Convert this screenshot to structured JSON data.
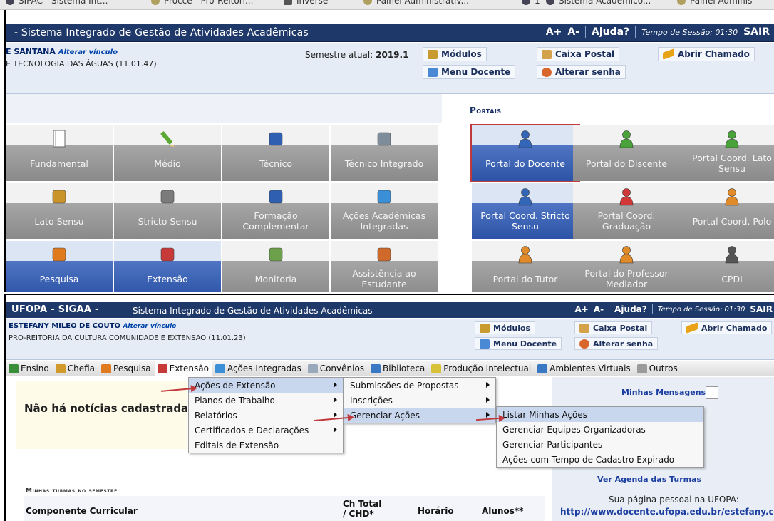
{
  "bookmarks": [
    {
      "label": "SIPAC - Sistema Int...",
      "icon": "sipac-icon"
    },
    {
      "label": "Procce - Pró-Reitori...",
      "icon": "folder-icon"
    },
    {
      "label": "Inverse",
      "icon": "inverse-icon"
    },
    {
      "label": "Painel Administrativ...",
      "icon": "folder-icon"
    },
    {
      "label": "1",
      "icon": "sipac-icon"
    },
    {
      "label": "Sistema Acadêmico...",
      "icon": "sipac-icon"
    },
    {
      "label": "Painel Adminis",
      "icon": "folder-icon"
    }
  ],
  "shot1": {
    "title": "Sistema Integrado de Gestão de Atividades Acadêmicas",
    "font_increase": "A+",
    "font_decrease": "A-",
    "help": "Ajuda?",
    "session_label": "Tempo de Sessão:",
    "session_time": "01:30",
    "logout": "SAIR",
    "user_name": "E SANTANA",
    "change_link": "Alterar vínculo",
    "unit": "E TECNOLOGIA DAS ÁGUAS (11.01.47)",
    "semester_label": "Semestre atual:",
    "semester_value": "2019.1",
    "quick_links": {
      "modulos": "Módulos",
      "caixa_postal": "Caixa Postal",
      "abrir_chamado": "Abrir Chamado",
      "menu_docente": "Menu Docente",
      "alterar_senha": "Alterar senha"
    },
    "portais_title": "Portais",
    "modules": [
      {
        "label": "Fundamental",
        "icon": "notebook-icon",
        "active": false
      },
      {
        "label": "Médio",
        "icon": "pencil-icon",
        "active": false
      },
      {
        "label": "Técnico",
        "icon": "book-icon",
        "active": false
      },
      {
        "label": "Técnico Integrado",
        "icon": "edit-icon",
        "active": false
      },
      {
        "label": "Lato Sensu",
        "icon": "folder-icon",
        "active": false
      },
      {
        "label": "Stricto Sensu",
        "icon": "briefcase-icon",
        "active": false
      },
      {
        "label": "Formação Complementar",
        "icon": "book-icon",
        "active": false
      },
      {
        "label": "Ações Acadêmicas Integradas",
        "icon": "puzzle-icon",
        "active": false
      },
      {
        "label": "Pesquisa",
        "icon": "flask-icon",
        "active": true
      },
      {
        "label": "Extensão",
        "icon": "gift-icon",
        "active": true
      },
      {
        "label": "Monitoria",
        "icon": "presentation-icon",
        "active": false
      },
      {
        "label": "Assistência ao Estudante",
        "icon": "people-icon",
        "active": false
      }
    ],
    "portals": [
      {
        "label": "Portal do Docente",
        "icon": "user-blue-icon",
        "active": true,
        "selected": true
      },
      {
        "label": "Portal do Discente",
        "icon": "user-green-icon",
        "active": false,
        "selected": false
      },
      {
        "label": "Portal Coord. Lato Sensu",
        "icon": "user-green-icon",
        "active": false,
        "selected": false
      },
      {
        "label": "Portal Coord. Stricto Sensu",
        "icon": "user-blue-icon",
        "active": true,
        "selected": false
      },
      {
        "label": "Portal Coord. Graduação",
        "icon": "user-red-icon",
        "active": false,
        "selected": false
      },
      {
        "label": "Portal Coord. Polo",
        "icon": "user-orange-icon",
        "active": false,
        "selected": false
      },
      {
        "label": "Portal do Tutor",
        "icon": "user-orange-icon",
        "active": false,
        "selected": false
      },
      {
        "label": "Portal do Professor Mediador",
        "icon": "user-orange-icon",
        "active": false,
        "selected": false
      },
      {
        "label": "CPDI",
        "icon": "user-suit-icon",
        "active": false,
        "selected": false
      }
    ]
  },
  "shot2": {
    "brand": "UFOPA - SIGAA -",
    "title": "Sistema Integrado de Gestão de Atividades Acadêmicas",
    "font_increase": "A+",
    "font_decrease": "A-",
    "help": "Ajuda?",
    "session_label": "Tempo de Sessão:",
    "session_time": "01:30",
    "logout": "SAIR",
    "user_name": "ESTEFANY MILEO DE COUTO",
    "change_link": "Alterar vínculo",
    "unit": "PRÓ-REITORIA DA CULTURA COMUNIDADE E EXTENSÃO (11.01.23)",
    "quick_links": {
      "modulos": "Módulos",
      "caixa_postal": "Caixa Postal",
      "abrir_chamado": "Abrir Chamado",
      "menu_docente": "Menu Docente",
      "alterar_senha": "Alterar senha"
    },
    "menu": [
      {
        "label": "Ensino",
        "icon": "ensino-icon"
      },
      {
        "label": "Chefia",
        "icon": "chefia-icon"
      },
      {
        "label": "Pesquisa",
        "icon": "flask-icon"
      },
      {
        "label": "Extensão",
        "icon": "gift-icon"
      },
      {
        "label": "Ações Integradas",
        "icon": "puzzle-icon"
      },
      {
        "label": "Convênios",
        "icon": "document-icon"
      },
      {
        "label": "Biblioteca",
        "icon": "library-icon"
      },
      {
        "label": "Produção Intelectual",
        "icon": "notepad-icon"
      },
      {
        "label": "Ambientes Virtuais",
        "icon": "network-icon"
      },
      {
        "label": "Outros",
        "icon": "gears-icon"
      }
    ],
    "submenu_l1": [
      "Ações de Extensão",
      "Planos de Trabalho",
      "Relatórios",
      "Certificados e Declarações",
      "Editais de Extensão"
    ],
    "submenu_l2": [
      "Submissões de Propostas",
      "Inscrições",
      "Gerenciar Ações"
    ],
    "submenu_l3": [
      "Listar Minhas Ações",
      "Gerenciar Equipes Organizadoras",
      "Gerenciar Participantes",
      "Ações com Tempo de Cadastro Expirado"
    ],
    "no_news": "Não há notícias cadastrada",
    "messages_link": "Minhas Mensagens",
    "agenda_link": "Ver Agenda das Turmas",
    "personal_page": "Sua página pessoal na UFOPA:",
    "personal_url": "http://www.docente.ufopa.edu.br/estefany.c",
    "turmas_title": "Minhas turmas no semestre",
    "table_headers": {
      "componente": "Componente Curricular",
      "ch": "Ch Total / CHD*",
      "horario": "Horário",
      "alunos": "Alunos**"
    }
  },
  "colors": {
    "header_blue": "#1e3869",
    "active_tile_blue": "#2c53a6",
    "inactive_tile_gray": "#8a8a8a",
    "highlight_red": "#c0393b",
    "info_bar": "#e5ecf6",
    "menu_highlight": "#c8d6ee",
    "link_blue": "#1b3ea0"
  }
}
